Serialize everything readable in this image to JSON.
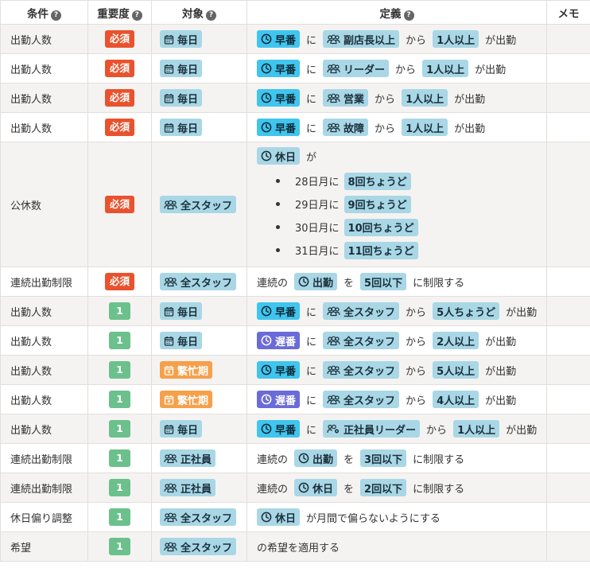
{
  "header": {
    "condition": "条件",
    "severity": "重要度",
    "target": "対象",
    "definition": "定義",
    "memo": "メモ",
    "help_glyph": "?"
  },
  "rows": [
    {
      "condition": "出勤人数",
      "severity": "必須",
      "target": "毎日",
      "target_icon": "calendar-icon",
      "def": {
        "shift": "早番",
        "p1": "に",
        "group": "副店長以上",
        "p2": "から",
        "count": "1人以上",
        "p3": "が出勤"
      }
    },
    {
      "condition": "出勤人数",
      "severity": "必須",
      "target": "毎日",
      "target_icon": "calendar-icon",
      "def": {
        "shift": "早番",
        "p1": "に",
        "group": "リーダー",
        "p2": "から",
        "count": "1人以上",
        "p3": "が出勤"
      }
    },
    {
      "condition": "出勤人数",
      "severity": "必須",
      "target": "毎日",
      "target_icon": "calendar-icon",
      "def": {
        "shift": "早番",
        "p1": "に",
        "group": "営業",
        "p2": "から",
        "count": "1人以上",
        "p3": "が出勤"
      }
    },
    {
      "condition": "出勤人数",
      "severity": "必須",
      "target": "毎日",
      "target_icon": "calendar-icon",
      "def": {
        "shift": "早番",
        "p1": "に",
        "group": "故障",
        "p2": "から",
        "count": "1人以上",
        "p3": "が出勤"
      }
    },
    {
      "condition": "公休数",
      "severity": "必須",
      "target": "全スタッフ",
      "target_icon": "people-icon",
      "holiday": {
        "shift": "休日",
        "p1": "が",
        "items": [
          {
            "month": "28日月に",
            "value": "8回ちょうど"
          },
          {
            "month": "29日月に",
            "value": "9回ちょうど"
          },
          {
            "month": "30日月に",
            "value": "10回ちょうど"
          },
          {
            "month": "31日月に",
            "value": "11回ちょうど"
          }
        ]
      }
    },
    {
      "condition": "連続出勤制限",
      "severity": "必須",
      "target": "全スタッフ",
      "target_icon": "people-icon",
      "consec": {
        "p0": "連続の",
        "shift": "出勤",
        "p1": "を",
        "count": "5回以下",
        "p2": "に制限する"
      }
    },
    {
      "condition": "出勤人数",
      "severity": "1",
      "target": "毎日",
      "target_icon": "calendar-icon",
      "def": {
        "shift": "早番",
        "p1": "に",
        "group": "全スタッフ",
        "p2": "から",
        "count": "5人ちょうど",
        "p3": "が出勤"
      }
    },
    {
      "condition": "出勤人数",
      "severity": "1",
      "target": "毎日",
      "target_icon": "calendar-icon",
      "def": {
        "shift": "遅番",
        "shift_late": true,
        "p1": "に",
        "group": "全スタッフ",
        "p2": "から",
        "count": "2人以上",
        "p3": "が出勤"
      }
    },
    {
      "condition": "出勤人数",
      "severity": "1",
      "target": "繁忙期",
      "target_icon": "calendar-star-icon",
      "target_orange": true,
      "def": {
        "shift": "早番",
        "p1": "に",
        "group": "全スタッフ",
        "p2": "から",
        "count": "5人以上",
        "p3": "が出勤"
      }
    },
    {
      "condition": "出勤人数",
      "severity": "1",
      "target": "繁忙期",
      "target_icon": "calendar-star-icon",
      "target_orange": true,
      "def": {
        "shift": "遅番",
        "shift_late": true,
        "p1": "に",
        "group": "全スタッフ",
        "p2": "から",
        "count": "4人以上",
        "p3": "が出勤"
      }
    },
    {
      "condition": "出勤人数",
      "severity": "1",
      "target": "毎日",
      "target_icon": "calendar-icon",
      "def": {
        "shift": "早番",
        "p1": "に",
        "group": "正社員リーダー",
        "group_icon": "people-gear-icon",
        "p2": "から",
        "count": "1人以上",
        "p3": "が出勤"
      }
    },
    {
      "condition": "連続出勤制限",
      "severity": "1",
      "target": "正社員",
      "target_icon": "people-icon",
      "consec": {
        "p0": "連続の",
        "shift": "出勤",
        "p1": "を",
        "count": "3回以下",
        "p2": "に制限する"
      }
    },
    {
      "condition": "連続出勤制限",
      "severity": "1",
      "target": "正社員",
      "target_icon": "people-icon",
      "consec": {
        "p0": "連続の",
        "shift": "休日",
        "p1": "を",
        "count": "2回以下",
        "p2": "に制限する"
      }
    },
    {
      "condition": "休日偏り調整",
      "severity": "1",
      "target": "全スタッフ",
      "target_icon": "people-icon",
      "bias": {
        "shift": "休日",
        "p1": "が月間で偏らないようにする"
      }
    },
    {
      "condition": "希望",
      "severity": "1",
      "target": "全スタッフ",
      "target_icon": "people-icon",
      "wish": {
        "text": "の希望を適用する"
      }
    }
  ]
}
